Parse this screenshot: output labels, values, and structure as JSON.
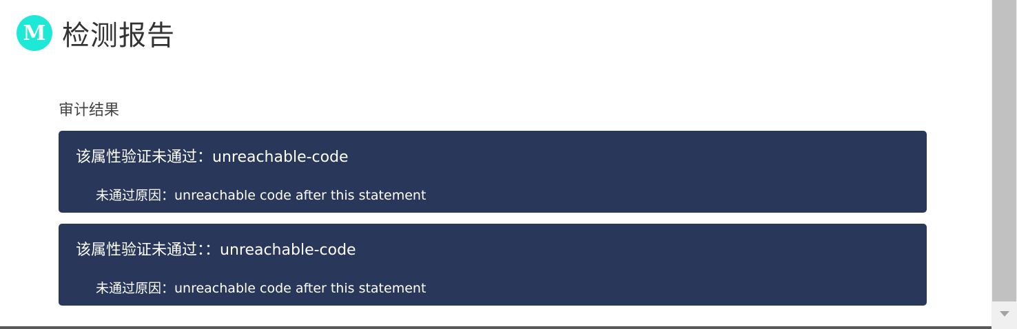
{
  "header": {
    "logo_letter": "M",
    "title": "检测报告"
  },
  "audit": {
    "section_title": "审计结果",
    "results": [
      {
        "title": "该属性验证未通过：unreachable-code",
        "reason": "未通过原因：unreachable code after this statement"
      },
      {
        "title": "该属性验证未通过：：unreachable-code",
        "reason": "未通过原因：unreachable code after this statement"
      }
    ]
  },
  "colors": {
    "logo_bg": "#1de9d6",
    "card_bg": "#29375a",
    "card_text": "#ffffff"
  },
  "icons": {
    "scroll_down": "triangle-down-icon"
  }
}
